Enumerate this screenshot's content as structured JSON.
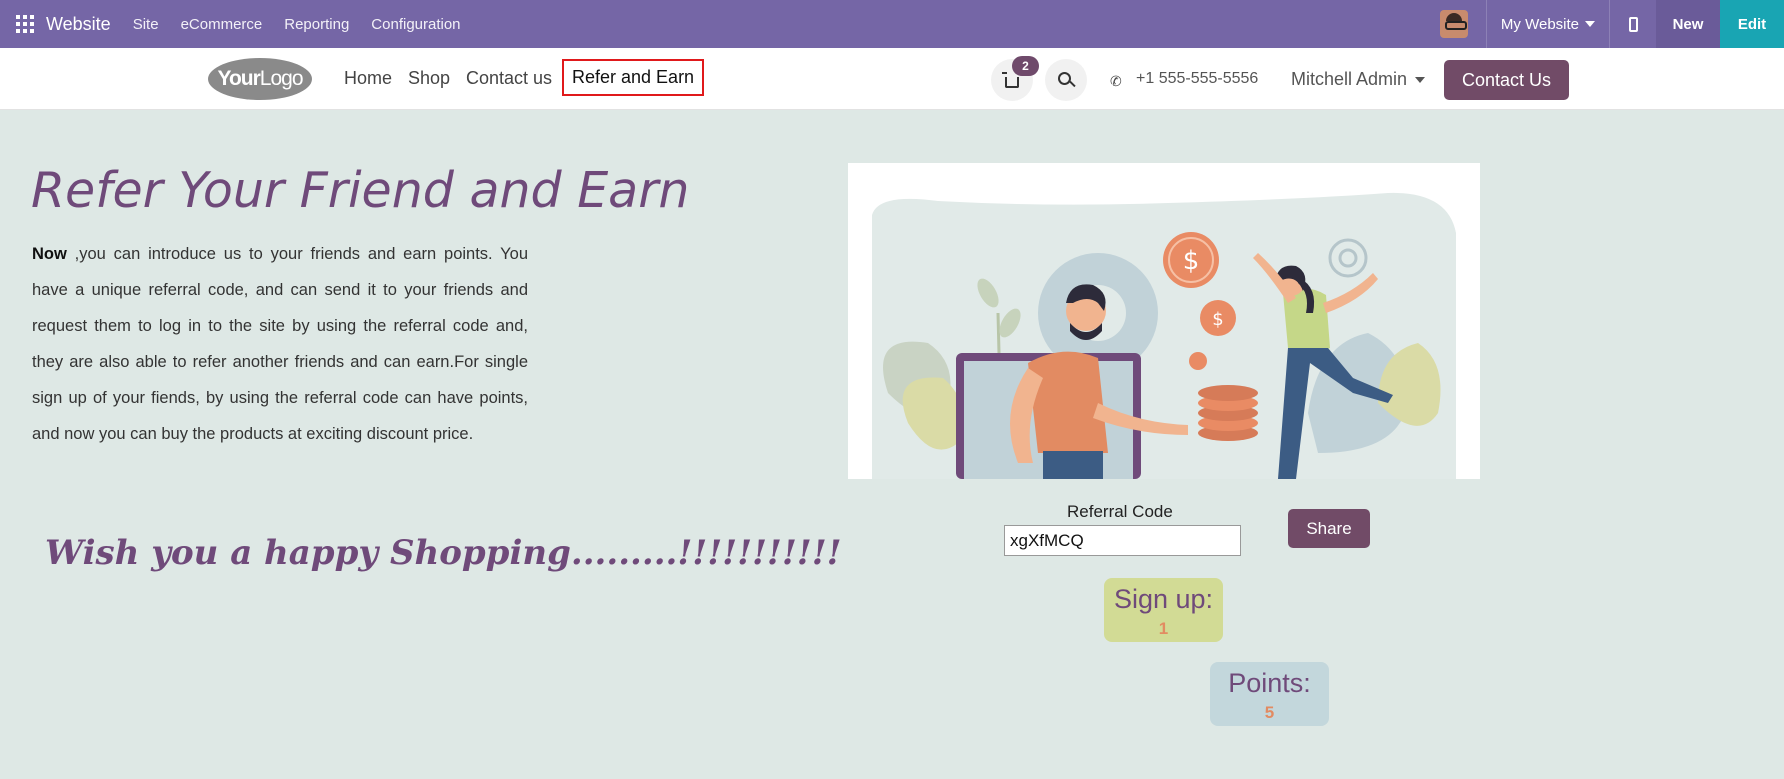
{
  "topbar": {
    "brand": "Website",
    "menu": [
      "Site",
      "eCommerce",
      "Reporting",
      "Configuration"
    ],
    "website_selector": "My Website",
    "new_label": "New",
    "edit_label": "Edit"
  },
  "header": {
    "logo_bold": "Your",
    "logo_light": "Logo",
    "nav": [
      "Home",
      "Shop",
      "Contact us",
      "Refer and Earn"
    ],
    "cart_count": "2",
    "phone": "+1 555-555-5556",
    "user": "Mitchell Admin",
    "contact_button": "Contact Us"
  },
  "main": {
    "title": "Refer Your Friend and Earn",
    "intro_bold": "Now",
    "intro_text": " ,you can introduce us to your friends and earn points. You have a unique referral code, and can send it to your friends and request them to log in to the site by using the referral code and, they are also able to refer another friends and can earn.For single sign up of your fiends, by using the referral code can have points, and now you can buy the products at exciting discount price.",
    "wish": "Wish you a happy Shopping.........!!!!!!!!!!!",
    "referral_label": "Referral Code",
    "referral_code": "xgXfMCQ",
    "share_label": "Share",
    "signup_label": "Sign up:",
    "signup_value": "1",
    "points_label": "Points:",
    "points_value": "5"
  },
  "colors": {
    "topbar": "#7566a6",
    "primary": "#714b67",
    "accent_orange": "#e28b62",
    "page_bg": "#dee8e5"
  }
}
